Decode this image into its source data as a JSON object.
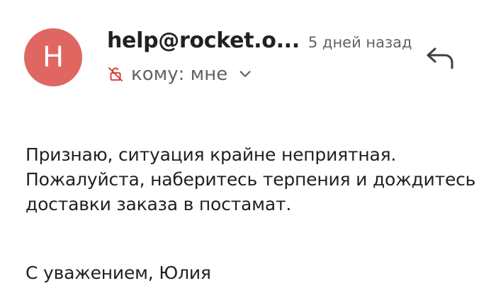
{
  "header": {
    "avatar_letter": "H",
    "avatar_color": "#e06661",
    "sender": "help@rocket.o...",
    "time": "5 дней назад",
    "to_label": "кому: мне",
    "lock_icon": "lock-off-icon",
    "expand_icon": "chevron-down-icon",
    "reply_icon": "reply-icon"
  },
  "message": {
    "lines": [
      "Признаю, ситуация крайне неприятная.",
      "Пожалуйста, наберитесь терпения и дождитесь",
      "доставки заказа в постамат."
    ],
    "signature": "С уважением, Юлия"
  },
  "colors": {
    "accent": "#e06661",
    "secondary_text": "#5f6368",
    "lock_icon": "#d93025"
  }
}
